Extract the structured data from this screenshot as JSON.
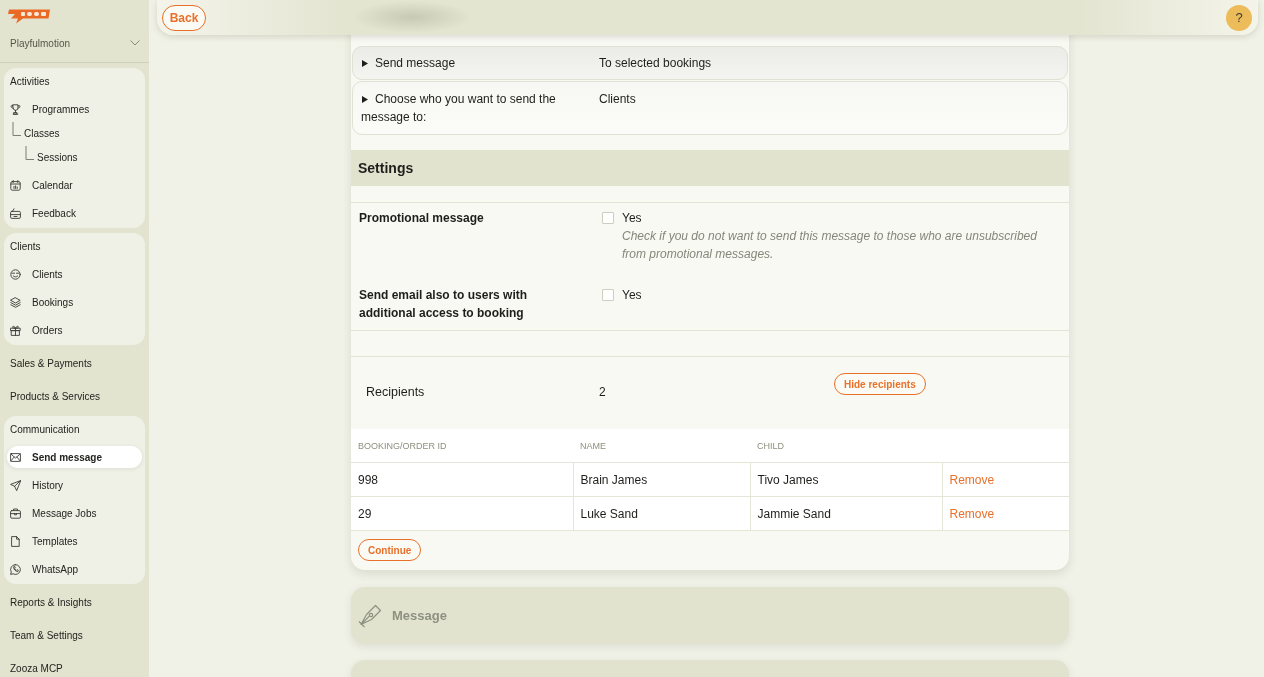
{
  "sidebar": {
    "account": "Playfulmotion",
    "sections": [
      {
        "kind": "group",
        "title": "Activities",
        "items": [
          {
            "label": "Programmes",
            "selected": false,
            "children": [
              {
                "label": "Classes",
                "selected": false,
                "children": [
                  {
                    "label": "Sessions",
                    "selected": false
                  }
                ]
              }
            ]
          },
          {
            "label": "Calendar",
            "selected": false
          },
          {
            "label": "Feedback",
            "selected": false
          }
        ]
      },
      {
        "kind": "group",
        "title": "Clients",
        "items": [
          {
            "label": "Clients",
            "selected": false
          },
          {
            "label": "Bookings",
            "selected": false
          },
          {
            "label": "Orders",
            "selected": false
          }
        ]
      },
      {
        "kind": "link",
        "label": "Sales & Payments"
      },
      {
        "kind": "link",
        "label": "Products & Services"
      },
      {
        "kind": "group",
        "title": "Communication",
        "items": [
          {
            "label": "Send message",
            "selected": true
          },
          {
            "label": "History",
            "selected": false
          },
          {
            "label": "Message Jobs",
            "selected": false
          },
          {
            "label": "Templates",
            "selected": false
          },
          {
            "label": "WhatsApp",
            "selected": false
          }
        ]
      },
      {
        "kind": "link",
        "label": "Reports & Insights"
      },
      {
        "kind": "link",
        "label": "Team & Settings"
      },
      {
        "kind": "link",
        "label": "Zooza MCP"
      }
    ]
  },
  "top_bar": {
    "back_button": "Back",
    "help_button": "?"
  },
  "summary": [
    {
      "label": "Send message",
      "value": "To selected bookings",
      "expanded": false
    },
    {
      "label": "Choose who you want to send the message to:",
      "value": "Clients",
      "expanded": false
    }
  ],
  "settings": {
    "title": "Settings",
    "options": [
      {
        "label": "Promotional message",
        "checked": false,
        "option_label": "Yes",
        "hint": "Check if you do not want to send this message to those who are unsubscribed from promotional messages."
      },
      {
        "label": "Send email also to users with additional access to booking",
        "checked": false,
        "option_label": "Yes"
      }
    ]
  },
  "recipients": {
    "label": "Recipients",
    "count": "2",
    "toggle_button": "Hide recipients",
    "table": {
      "columns": [
        "BOOKING/ORDER ID",
        "NAME",
        "CHILD"
      ],
      "rows": [
        {
          "booking_order_id": "998",
          "name": "Brain James",
          "child": "Tivo James",
          "action": "Remove"
        },
        {
          "booking_order_id": "29",
          "name": "Luke Sand",
          "child": "Jammie Sand",
          "action": "Remove"
        }
      ]
    }
  },
  "continue_button": "Continue",
  "collapsed_sections": [
    {
      "title": "Message"
    }
  ]
}
